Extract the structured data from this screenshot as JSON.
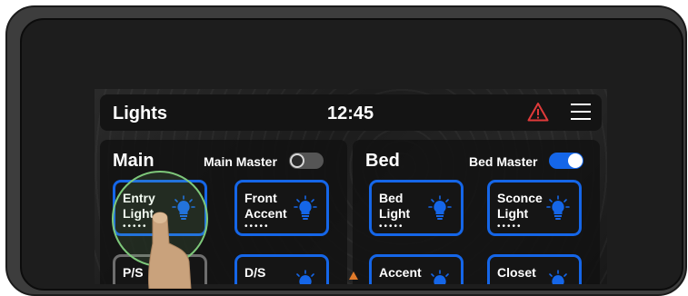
{
  "colors": {
    "accent": "#1566e8",
    "alert": "#e03a3a",
    "background": "#1d1d1d"
  },
  "topbar": {
    "title": "Lights",
    "time": "12:45",
    "alert_icon": "warning-triangle-icon",
    "menu_icon": "hamburger-menu-icon"
  },
  "zones": [
    {
      "title": "Main",
      "master_label": "Main Master",
      "master_on": false,
      "tiles": [
        {
          "line1": "Entry",
          "line2": "Light",
          "dots": "•••••",
          "on": true
        },
        {
          "line1": "Front",
          "line2": "Accent",
          "dots": "•••••",
          "on": true
        },
        {
          "line1": "P/S",
          "line2": "",
          "dots": "",
          "on": false
        },
        {
          "line1": "D/S",
          "line2": "",
          "dots": "",
          "on": true
        }
      ]
    },
    {
      "title": "Bed",
      "master_label": "Bed Master",
      "master_on": true,
      "tiles": [
        {
          "line1": "Bed",
          "line2": "Light",
          "dots": "•••••",
          "on": true
        },
        {
          "line1": "Sconce",
          "line2": "Light",
          "dots": "•••••",
          "on": true
        },
        {
          "line1": "Accent",
          "line2": "",
          "dots": "",
          "on": true
        },
        {
          "line1": "Closet",
          "line2": "",
          "dots": "",
          "on": true
        }
      ]
    }
  ]
}
